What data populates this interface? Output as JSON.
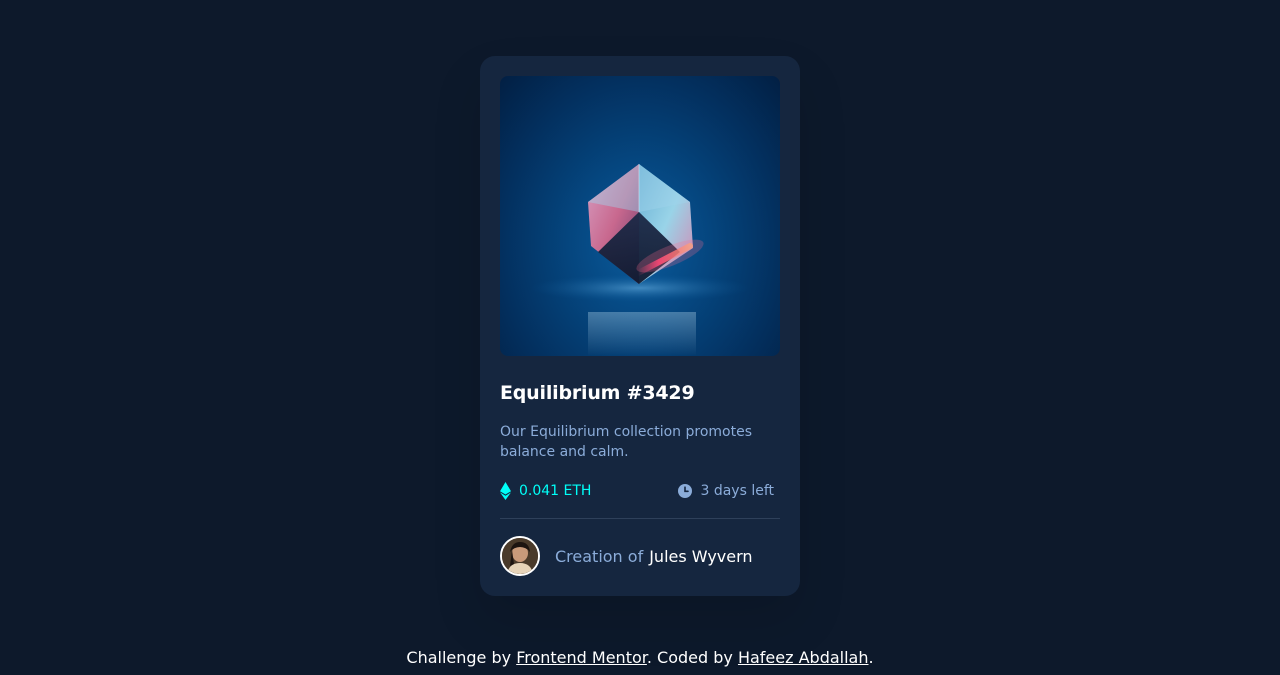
{
  "colors": {
    "page_background": "#0d192b",
    "card_background": "#15263f",
    "accent_cyan": "#00fff8",
    "muted_blue": "#8bacd9",
    "white": "#ffffff",
    "divider": "#2e405a"
  },
  "card": {
    "image_icon": "crystal-cube-image",
    "title": "Equilibrium #3429",
    "description": "Our Equilibrium collection promotes balance and calm.",
    "price": {
      "icon": "ethereum-icon",
      "value": "0.041 ETH"
    },
    "time": {
      "icon": "clock-icon",
      "value": "3 days left"
    },
    "creator": {
      "avatar_icon": "avatar",
      "label": "Creation of",
      "name": "Jules Wyvern"
    }
  },
  "attribution": {
    "prefix": "Challenge by",
    "challenge_link": "Frontend Mentor",
    "middle": ". Coded by",
    "author_link": "Hafeez Abdallah",
    "suffix": "."
  }
}
